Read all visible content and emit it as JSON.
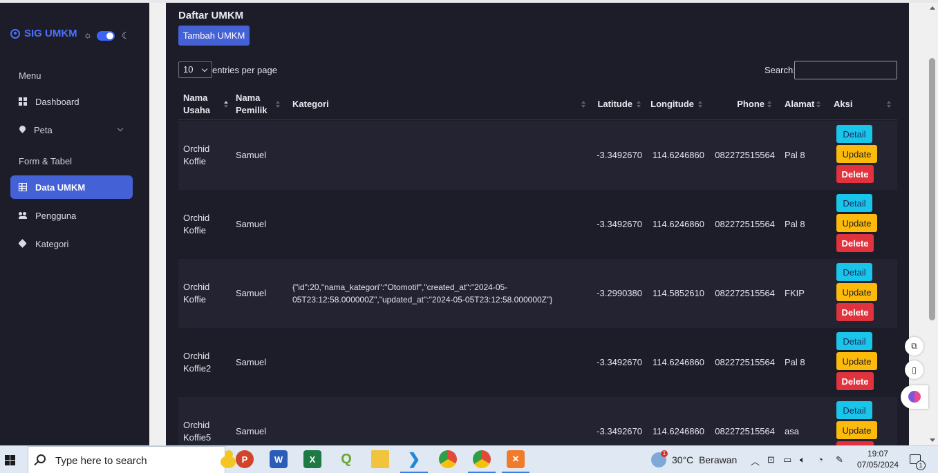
{
  "sidebar": {
    "brand": "SIG UMKM",
    "menu_heading": "Menu",
    "dashboard": "Dashboard",
    "peta": "Peta",
    "form_heading": "Form & Tabel",
    "data_umkm": "Data UMKM",
    "pengguna": "Pengguna",
    "kategori": "Kategori",
    "theme_toggle_on": true
  },
  "main": {
    "title": "Daftar UMKM",
    "add_button": "Tambah UMKM",
    "entries_value": "10",
    "entries_label": "entries per page",
    "search_label": "Search:",
    "search_value": ""
  },
  "table": {
    "headers": {
      "nama_usaha_1": "Nama",
      "nama_usaha_2": "Usaha",
      "nama_pemilik_1": "Nama",
      "nama_pemilik_2": "Pemilik",
      "kategori": "Kategori",
      "latitude": "Latitude",
      "longitude": "Longitude",
      "phone": "Phone",
      "alamat": "Alamat",
      "aksi": "Aksi"
    },
    "actions": {
      "detail": "Detail",
      "update": "Update",
      "delete": "Delete"
    },
    "rows": [
      {
        "usaha_1": "Orchid",
        "usaha_2": "Koffie",
        "pemilik": "Samuel",
        "kategori_1": "",
        "kategori_2": "",
        "latitude": "-3.3492670",
        "longitude": "114.6246860",
        "phone": "082272515564",
        "alamat": "Pal 8"
      },
      {
        "usaha_1": "Orchid",
        "usaha_2": "Koffie",
        "pemilik": "Samuel",
        "kategori_1": "",
        "kategori_2": "",
        "latitude": "-3.3492670",
        "longitude": "114.6246860",
        "phone": "082272515564",
        "alamat": "Pal 8"
      },
      {
        "usaha_1": "Orchid",
        "usaha_2": "Koffie",
        "pemilik": "Samuel",
        "kategori_1": "{\"id\":20,\"nama_kategori\":\"Otomotif\",\"created_at\":\"2024-05-",
        "kategori_2": "05T23:12:58.000000Z\",\"updated_at\":\"2024-05-05T23:12:58.000000Z\"}",
        "latitude": "-3.2990380",
        "longitude": "114.5852610",
        "phone": "082272515564",
        "alamat": "FKIP"
      },
      {
        "usaha_1": "Orchid",
        "usaha_2": "Koffie2",
        "pemilik": "Samuel",
        "kategori_1": "",
        "kategori_2": "",
        "latitude": "-3.3492670",
        "longitude": "114.6246860",
        "phone": "082272515564",
        "alamat": "Pal 8"
      },
      {
        "usaha_1": "Orchid",
        "usaha_2": "Koffie5",
        "pemilik": "Samuel",
        "kategori_1": "",
        "kategori_2": "",
        "latitude": "-3.3492670",
        "longitude": "114.6246860",
        "phone": "082272515564",
        "alamat": "asa"
      }
    ]
  },
  "taskbar": {
    "search_placeholder": "Type here to search",
    "weather_temp": "30°C",
    "weather_desc": "Berawan",
    "weather_badge": "1",
    "time": "19:07",
    "date": "07/05/2024",
    "notif_count": "1",
    "apps": [
      "powerpoint-icon",
      "word-icon",
      "excel-icon",
      "qgis-icon",
      "file-explorer-icon",
      "vscode-icon",
      "chrome-icon",
      "chrome-profile-icon",
      "xampp-icon"
    ]
  },
  "colors": {
    "accent": "#4561d6",
    "detail": "#19c6ea",
    "update": "#fcbb0c",
    "delete": "#e0333d",
    "background": "#1d1d29"
  }
}
